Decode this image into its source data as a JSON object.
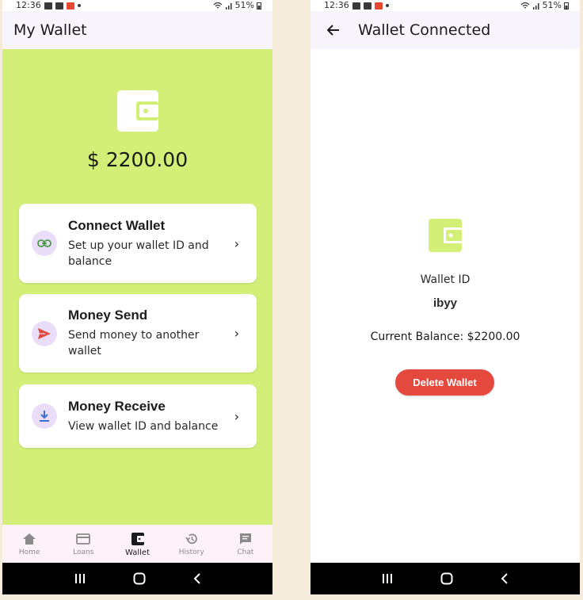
{
  "colors": {
    "background": "#f4ebda",
    "wallet_panel": "#d4ef78",
    "icon_circle": "#e9ddf7",
    "delete_button": "#e5483d",
    "bottom_nav": "#fdf2f7"
  },
  "status_bar": {
    "time": "12:36",
    "battery": "51%"
  },
  "left_screen": {
    "title": "My Wallet",
    "wallet_icon": "wallet-icon",
    "balance": "$ 2200.00",
    "cards": [
      {
        "title": "Connect Wallet",
        "subtitle": "Set up your wallet ID and balance",
        "icon": "link-icon"
      },
      {
        "title": "Money Send",
        "subtitle": "Send money to another wallet",
        "icon": "send-icon"
      },
      {
        "title": "Money Receive",
        "subtitle": "View wallet ID and balance",
        "icon": "download-icon"
      }
    ],
    "bottom_nav": [
      {
        "label": "Home",
        "icon": "home-icon"
      },
      {
        "label": "Loans",
        "icon": "credit-card-icon"
      },
      {
        "label": "Wallet",
        "icon": "wallet-icon",
        "active": true
      },
      {
        "label": "History",
        "icon": "history-icon"
      },
      {
        "label": "Chat",
        "icon": "chat-icon"
      }
    ]
  },
  "right_screen": {
    "title": "Wallet Connected",
    "wallet_id_label": "Wallet ID",
    "wallet_id_value": "ibyy",
    "current_balance": "Current Balance: $2200.00",
    "delete_button": "Delete Wallet"
  }
}
